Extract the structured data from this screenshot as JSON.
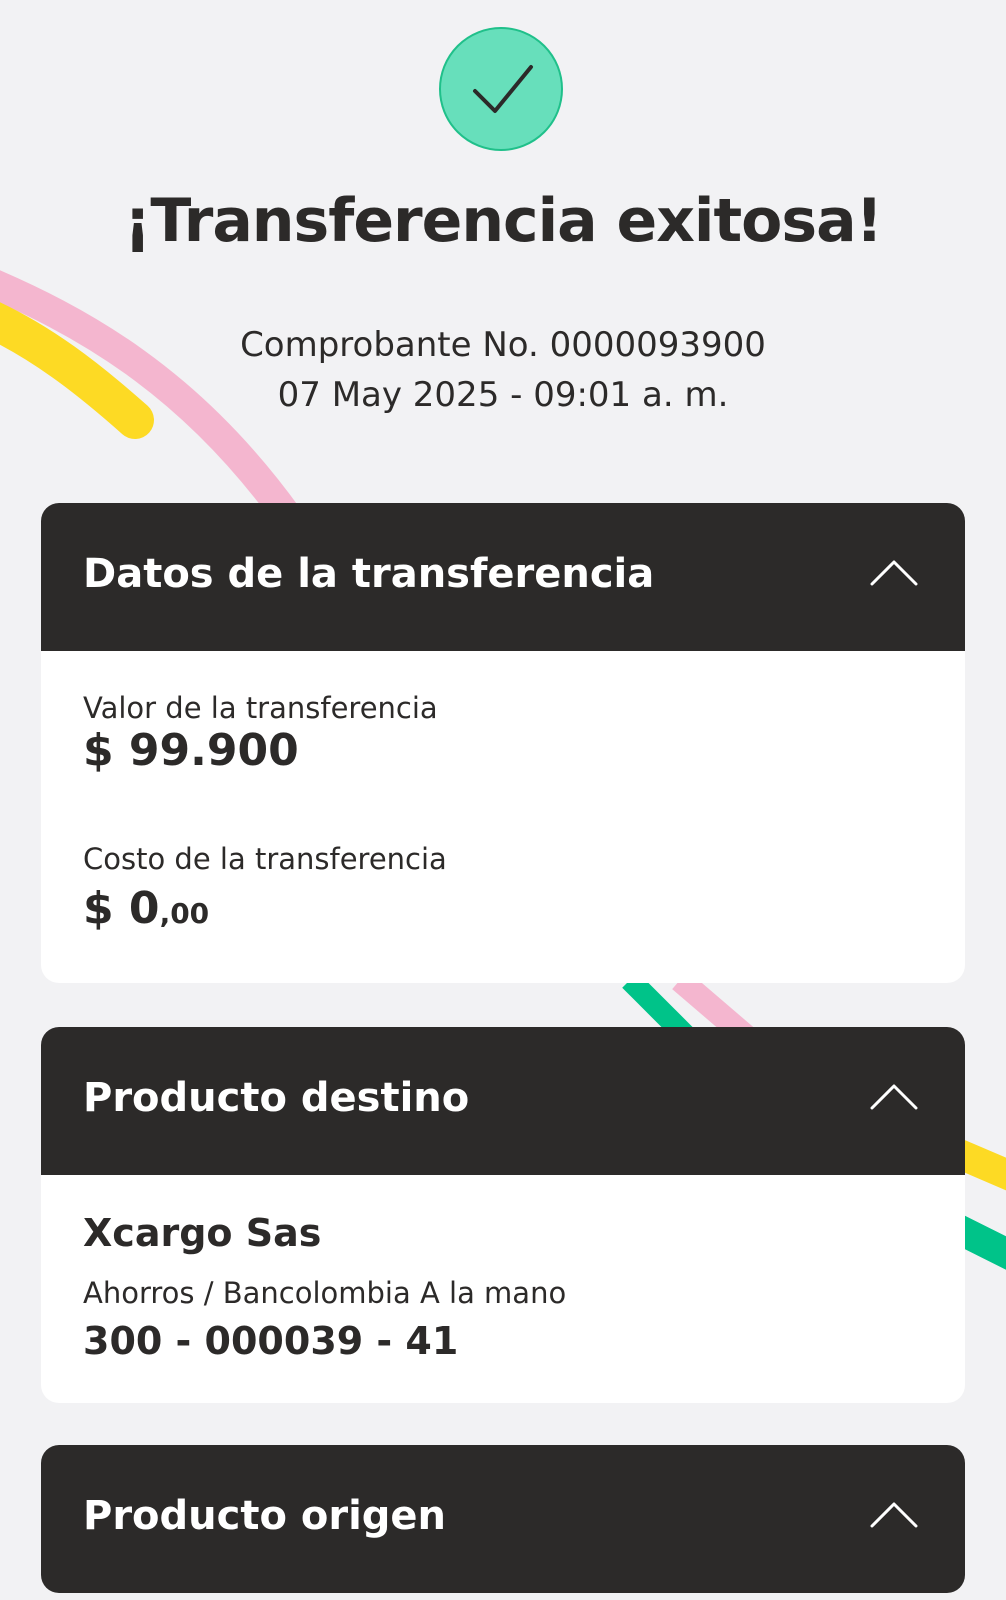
{
  "header": {
    "title": "¡Transferencia exitosa!",
    "receipt": "Comprobante No. 0000093900",
    "datetime": "07 May 2025 - 09:01 a. m."
  },
  "transfer": {
    "title": "Datos de la transferencia",
    "value_label": "Valor de la transferencia",
    "value_amount": "$ 99.900",
    "cost_label": "Costo de la transferencia",
    "cost_amount": "$ 0",
    "cost_cents": ",00"
  },
  "destination": {
    "title": "Producto destino",
    "name": "Xcargo Sas",
    "type": "Ahorros / Bancolombia A la mano",
    "account": "300 - 000039 - 41"
  },
  "origin": {
    "title": "Producto origen"
  },
  "icons": {
    "success": "check-icon",
    "collapse": "chevron-up-icon"
  },
  "colors": {
    "header_bg": "#2c2a29",
    "success_green": "#67dfbb",
    "page_bg": "#f2f2f4",
    "deco_pink": "#f4b6cf",
    "deco_yellow": "#fdda24",
    "deco_green": "#00c389"
  }
}
